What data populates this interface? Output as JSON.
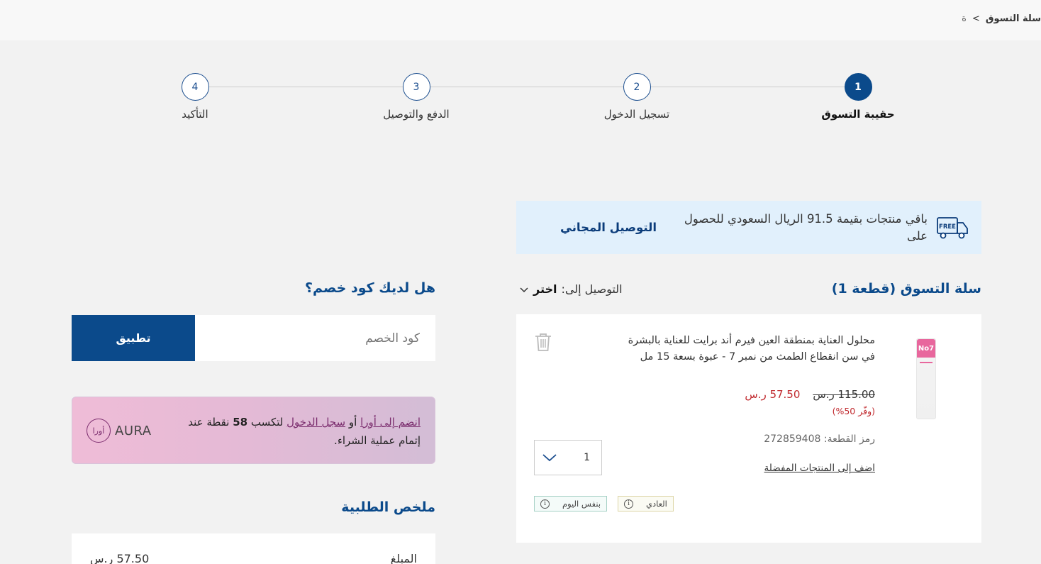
{
  "breadcrumb": {
    "current": "سلة التسوق",
    "separator": ">",
    "previous": "ة"
  },
  "steps": [
    {
      "number": "1",
      "label": "حقيبة التسوق"
    },
    {
      "number": "2",
      "label": "تسجيل الدخول"
    },
    {
      "number": "3",
      "label": "الدفع والتوصيل"
    },
    {
      "number": "4",
      "label": "التأكيد"
    }
  ],
  "free_banner": {
    "icon_text": "FREE",
    "message": "باقي منتجات بقيمة 91.5 الريال السعودي للحصول على",
    "bold": "التوصيل المجاني"
  },
  "cart": {
    "title": "سلة التسوق (قطعة 1)",
    "deliver_label": "التوصيل إلى:",
    "deliver_choose": "اختر",
    "item": {
      "image_brand": "No7",
      "name": "محلول العناية بمنطقة العين فيرم أند برايت للعناية بالبشرة في سن انقطاع الطمث من نمبر 7 - عبوة بسعة 15 مل",
      "old_price": "115.00 ر.س",
      "new_price": "57.50 ر.س",
      "save": "(وفّر 50%)",
      "sku": "رمز القطعة: 272859408",
      "fav_link": "اضف إلى المنتجات المفضلة",
      "quantity": "1",
      "badge_normal": "العادي",
      "badge_sameday": "بنفس اليوم",
      "info_glyph": "i"
    }
  },
  "coupon": {
    "title": "هل لديك كود خصم؟",
    "placeholder": "كود الخصم",
    "apply_label": "تطبيق"
  },
  "aura": {
    "logo_word": "AURA",
    "logo_ring": "أورا",
    "join_link": "انضم إلى أورا",
    "or": "أو",
    "login_link": "سجل الدخول",
    "earn": "لتكسب",
    "points": "58",
    "rest": "نقطة عند إتمام عملية الشراء."
  },
  "summary": {
    "title": "ملخص الطلبية",
    "amount_label": "المبلغ",
    "amount_value": "57.50 ر.س"
  },
  "colors": {
    "brand_blue": "#0b4a8b",
    "sale_red": "#c0282d",
    "banner_bg": "#e1f0fc",
    "aura_accent": "#7b2d6e"
  }
}
